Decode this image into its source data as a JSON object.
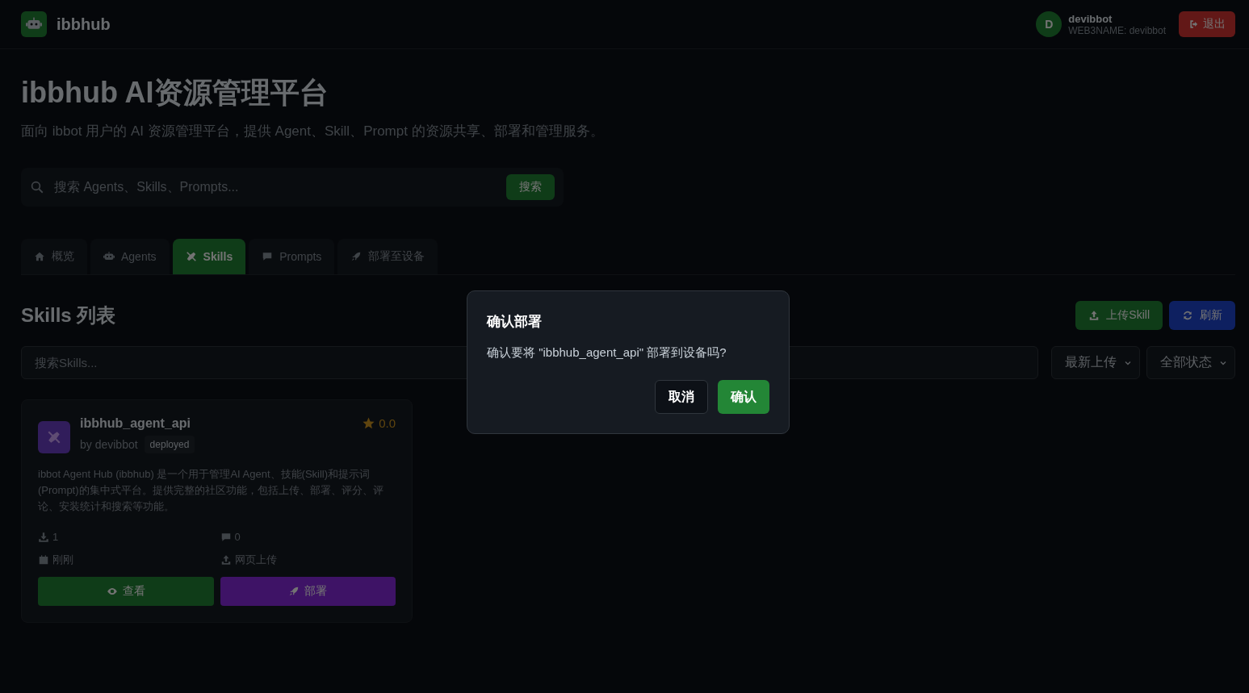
{
  "header": {
    "brand": "ibbhub",
    "user": {
      "initial": "D",
      "name": "devibbot",
      "subtitle": "WEB3NAME: devibbot"
    },
    "logout": "退出"
  },
  "hero": {
    "title": "ibbhub AI资源管理平台",
    "subtitle": "面向 ibbot 用户的 AI 资源管理平台，提供 Agent、Skill、Prompt 的资源共享、部署和管理服务。",
    "search": {
      "placeholder": "搜索 Agents、Skills、Prompts...",
      "button": "搜索"
    }
  },
  "tabs": [
    {
      "label": "概览",
      "selected": false
    },
    {
      "label": "Agents",
      "selected": false
    },
    {
      "label": "Skills",
      "selected": true
    },
    {
      "label": "Prompts",
      "selected": false
    },
    {
      "label": "部署至设备",
      "selected": false
    }
  ],
  "section": {
    "title": "Skills 列表",
    "actions": [
      {
        "label": "上传Skill",
        "kind": "upload"
      },
      {
        "label": "刷新",
        "kind": "refresh"
      }
    ]
  },
  "filters": {
    "search_placeholder": "搜索Skills...",
    "selects": [
      "最新上传",
      "全部状态"
    ]
  },
  "cards": [
    {
      "name": "ibbhub_agent_api",
      "author": "by devibbot",
      "status": "deployed",
      "rating": "0.0",
      "description": "ibbot Agent Hub (ibbhub) 是一个用于管理AI Agent、技能(Skill)和提示词(Prompt)的集中式平台。提供完整的社区功能，包括上传、部署、评分、评论、安装统计和搜索等功能。",
      "stats": [
        "1",
        "0",
        "刚刚",
        "网页上传"
      ],
      "buttons": [
        {
          "label": "查看",
          "kind": "view"
        },
        {
          "label": "部署",
          "kind": "deploy"
        }
      ]
    }
  ],
  "modal": {
    "title": "确认部署",
    "message": "确认要将 \"ibbhub_agent_api\" 部署到设备吗?",
    "cancel": "取消",
    "confirm": "确认"
  }
}
